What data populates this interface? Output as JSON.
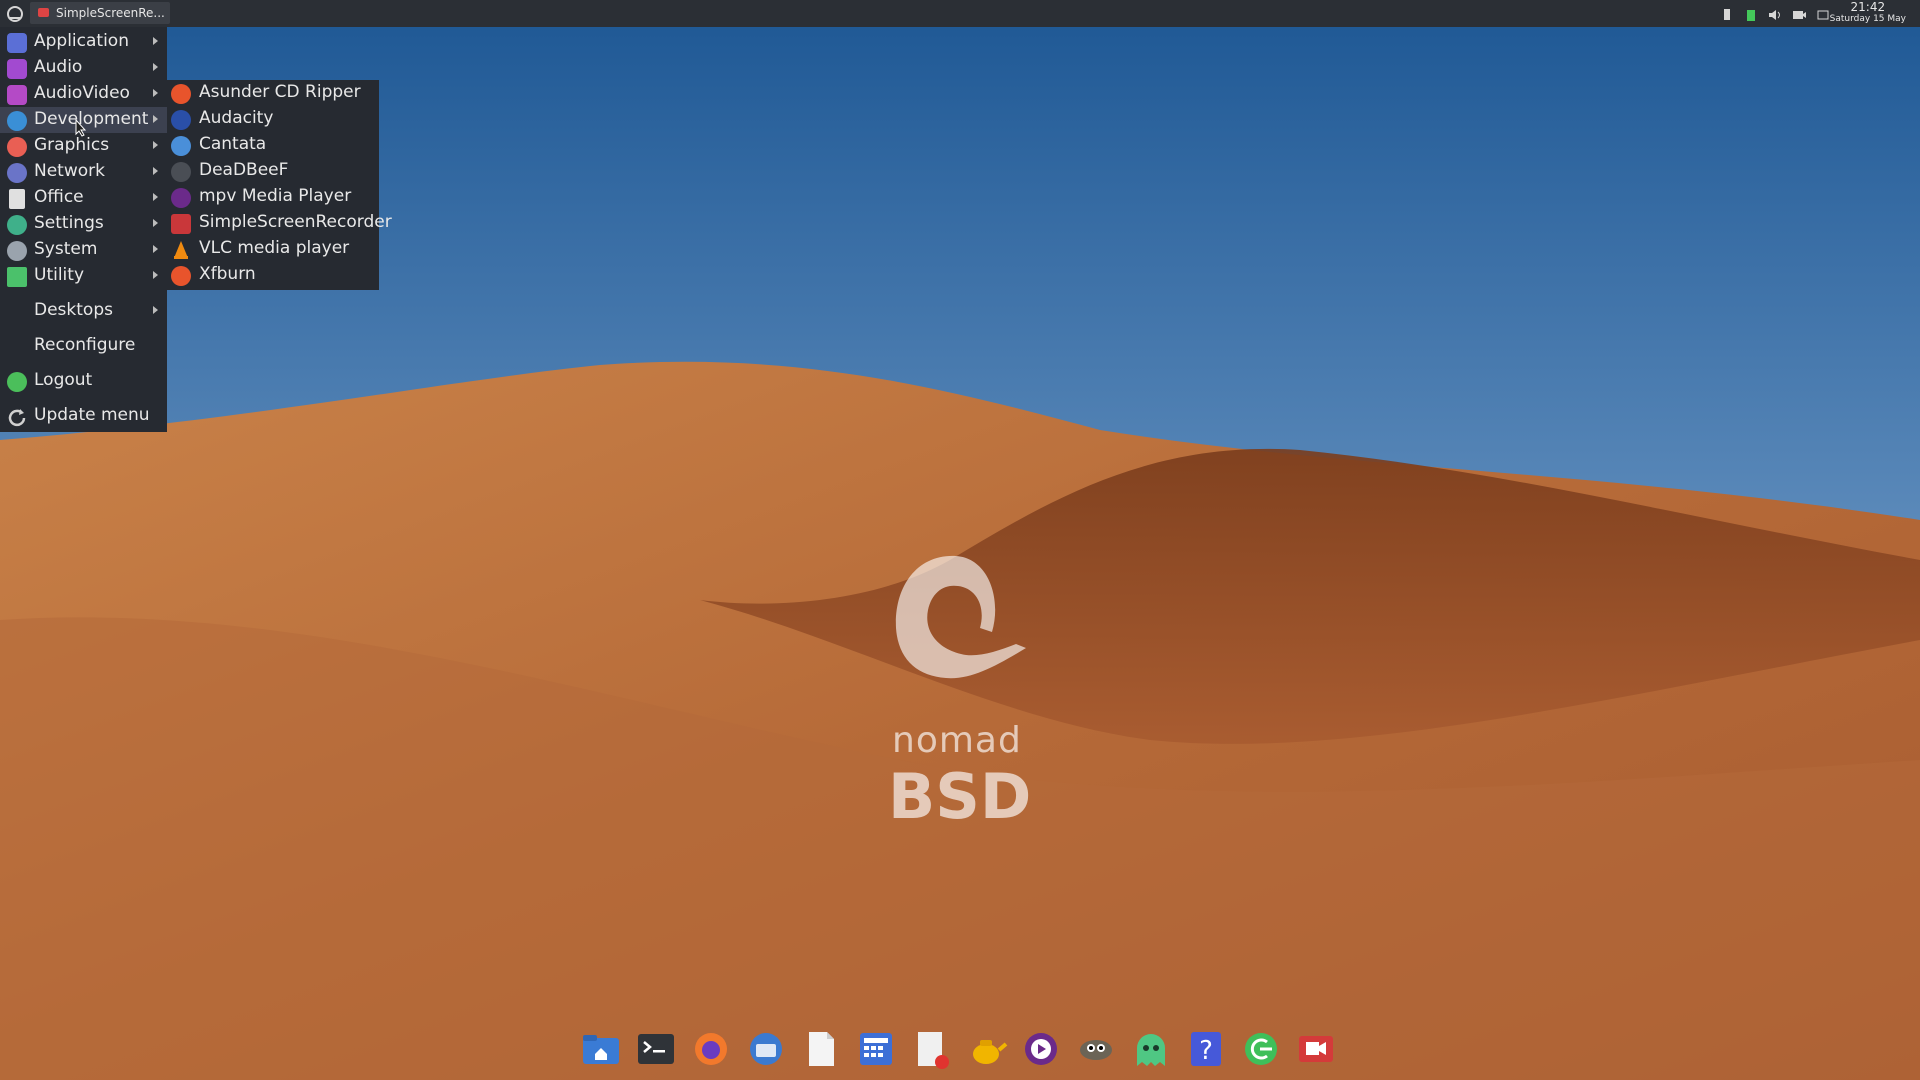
{
  "taskbar": {
    "task_title": "SimpleScreenRe...",
    "clock_time": "21:42",
    "clock_date": "Saturday 15 May"
  },
  "main_menu": {
    "items": [
      {
        "label": "Application",
        "icon": "application-icon",
        "color": "#5b6fd6",
        "has_submenu": true
      },
      {
        "label": "Audio",
        "icon": "audio-icon",
        "color": "#a24ad0",
        "has_submenu": true
      },
      {
        "label": "AudioVideo",
        "icon": "audiovideo-icon",
        "color": "#b44ac6",
        "has_submenu": true
      },
      {
        "label": "Development",
        "icon": "development-icon",
        "color": "#3a8fd6",
        "has_submenu": true
      },
      {
        "label": "Graphics",
        "icon": "graphics-icon",
        "color": "#e95f54",
        "has_submenu": true
      },
      {
        "label": "Network",
        "icon": "network-icon",
        "color": "#6a74c8",
        "has_submenu": true
      },
      {
        "label": "Office",
        "icon": "office-icon",
        "color": "#e0e0e0",
        "has_submenu": true
      },
      {
        "label": "Settings",
        "icon": "settings-icon",
        "color": "#3fb08a",
        "has_submenu": true
      },
      {
        "label": "System",
        "icon": "system-icon",
        "color": "#9aa3ad",
        "has_submenu": true
      },
      {
        "label": "Utility",
        "icon": "utility-icon",
        "color": "#4bc16b",
        "has_submenu": true
      },
      {
        "label": "Desktops",
        "icon": "",
        "color": "",
        "has_submenu": true
      },
      {
        "label": "Reconfigure",
        "icon": "",
        "color": "",
        "has_submenu": false
      },
      {
        "label": "Logout",
        "icon": "logout-icon",
        "color": "#4bbf5b",
        "has_submenu": false
      },
      {
        "label": "Update menu",
        "icon": "refresh-icon",
        "color": "#d0d0d0",
        "has_submenu": false
      }
    ],
    "active_item": "Development"
  },
  "sub_menu": {
    "items": [
      {
        "label": "Asunder CD Ripper",
        "icon": "asunder-icon",
        "color": "#e8542c"
      },
      {
        "label": "Audacity",
        "icon": "audacity-icon",
        "color": "#2a4fa8"
      },
      {
        "label": "Cantata",
        "icon": "cantata-icon",
        "color": "#4a8fd9"
      },
      {
        "label": "DeaDBeeF",
        "icon": "deadbeef-icon",
        "color": "#4a4e55"
      },
      {
        "label": "mpv Media Player",
        "icon": "mpv-icon",
        "color": "#6b2a8a"
      },
      {
        "label": "SimpleScreenRecorder",
        "icon": "simplescreenrecorder-icon",
        "color": "#c9373a"
      },
      {
        "label": "VLC media player",
        "icon": "vlc-icon",
        "color": "#f08a10"
      },
      {
        "label": "Xfburn",
        "icon": "xfburn-icon",
        "color": "#e8542c"
      }
    ]
  },
  "wallpaper": {
    "logo_line1": "nomad",
    "logo_line2": "BSD"
  },
  "dock": {
    "items": [
      {
        "icon": "file-manager-icon",
        "color": "#3a7bd5"
      },
      {
        "icon": "terminal-icon",
        "color": "#2f3338"
      },
      {
        "icon": "firefox-icon",
        "color": "#f2792c"
      },
      {
        "icon": "thunderbird-icon",
        "color": "#3b7ad0"
      },
      {
        "icon": "text-document-icon",
        "color": "#f4f4f4"
      },
      {
        "icon": "calculator-icon",
        "color": "#3d6fd6"
      },
      {
        "icon": "text-editor-icon",
        "color": "#f0f0f0"
      },
      {
        "icon": "teapot-icon",
        "color": "#f1b500"
      },
      {
        "icon": "media-player-icon",
        "color": "#6b2a8a"
      },
      {
        "icon": "gimp-icon",
        "color": "#6b6456"
      },
      {
        "icon": "ghost-icon",
        "color": "#4fc783"
      },
      {
        "icon": "help-icon",
        "color": "#4659d9"
      },
      {
        "icon": "logout-icon",
        "color": "#3fbf5a"
      },
      {
        "icon": "screen-recorder-icon",
        "color": "#d43a3a"
      }
    ]
  }
}
